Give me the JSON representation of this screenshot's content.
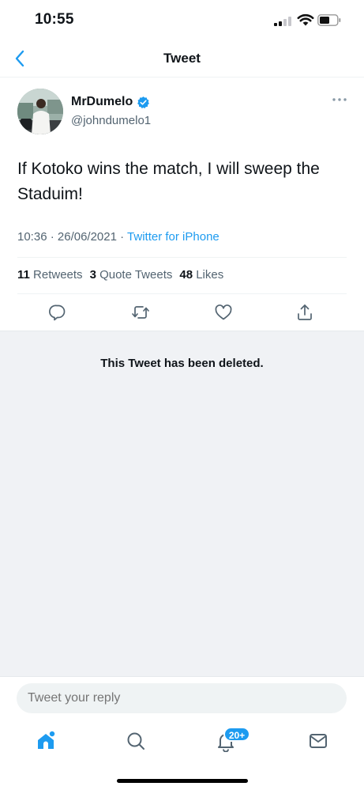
{
  "status_bar": {
    "time": "10:55",
    "icons": [
      "cellular-signal-icon",
      "wifi-icon",
      "battery-icon"
    ]
  },
  "header": {
    "title": "Tweet",
    "back_icon": "chevron-left-icon"
  },
  "tweet": {
    "display_name": "MrDumelo",
    "handle": "@johndumelo1",
    "verified": true,
    "text": "If Kotoko wins the match, I will sweep the Staduim!",
    "time": "10:36",
    "date": "26/06/2021",
    "separator": "·",
    "client": "Twitter for iPhone",
    "stats": {
      "retweets_count": "11",
      "retweets_label": "Retweets",
      "quotes_count": "3",
      "quotes_label": "Quote Tweets",
      "likes_count": "48",
      "likes_label": "Likes"
    },
    "actions": [
      "reply-icon",
      "retweet-icon",
      "like-icon",
      "share-icon"
    ]
  },
  "deleted_notice": "This Tweet has been deleted.",
  "reply": {
    "placeholder": "Tweet your reply"
  },
  "tab_bar": {
    "tabs": [
      "home-icon",
      "search-icon",
      "notifications-icon",
      "messages-icon"
    ],
    "notifications_badge": "20+"
  },
  "colors": {
    "accent": "#1d9bf0",
    "text_primary": "#0f1419",
    "text_secondary": "#536471",
    "deleted_background": "#f0f2f5"
  }
}
